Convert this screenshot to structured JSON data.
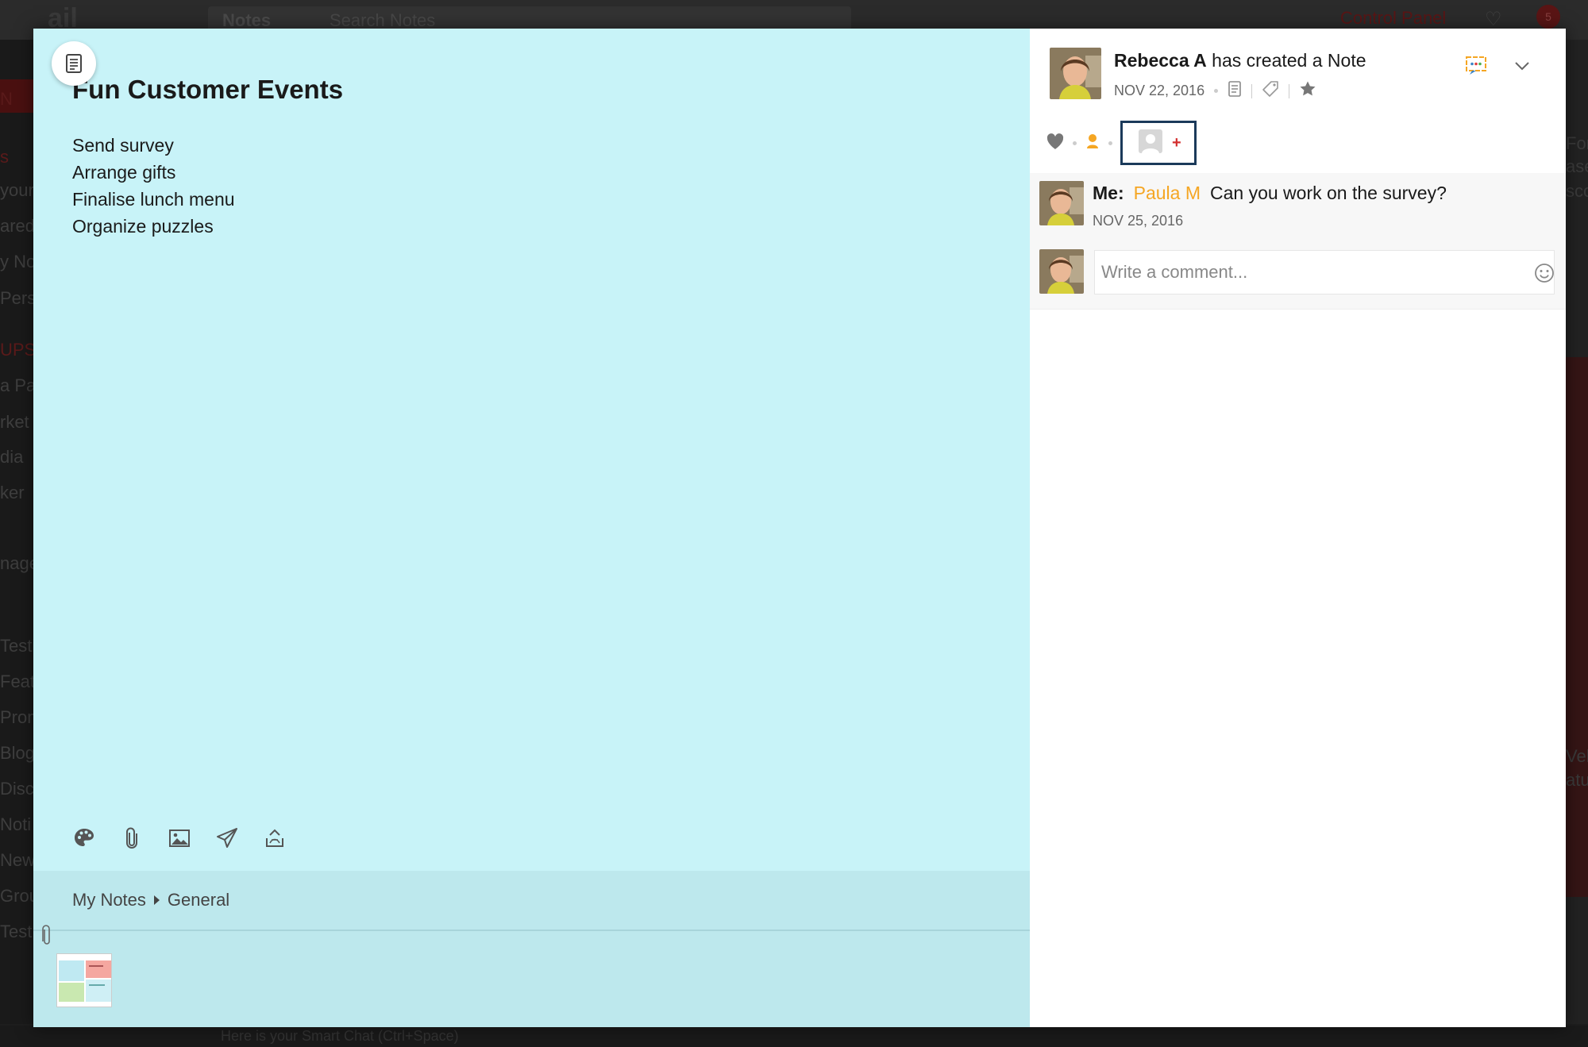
{
  "background": {
    "logo": "ail",
    "search_scope": "Notes",
    "search_placeholder": "Search Notes",
    "control_panel": "Control Panel",
    "notification_count": "5",
    "sidebar_fragments": [
      "N",
      "s",
      "youri",
      "ared",
      "y Not",
      "Perso",
      "UPS",
      "a Pa",
      "rket",
      "dia",
      "ker",
      "nage",
      "Testi",
      "Feat",
      "Prom",
      "Blog",
      "Disc",
      "Noti",
      "New",
      "Grou",
      "Test"
    ],
    "right_fragments": [
      "For",
      "ase",
      "sco",
      "Veb",
      "atu"
    ],
    "bottom_text": "Here is your Smart Chat (Ctrl+Space)"
  },
  "note": {
    "title": "Fun Customer Events",
    "lines": [
      "Send survey",
      "Arrange gifts",
      "Finalise lunch menu",
      "Organize puzzles"
    ],
    "toolbar": [
      "palette-icon",
      "attach-icon",
      "image-icon",
      "send-icon",
      "scan-icon"
    ],
    "breadcrumb": {
      "root": "My Notes",
      "child": "General"
    }
  },
  "feed": {
    "author": "Rebecca A",
    "action": "has created a Note",
    "date": "NOV 22, 2016",
    "comment": {
      "prefix": "Me:",
      "mention": "Paula M",
      "text": "Can you work on the survey?",
      "date": "NOV 25, 2016"
    },
    "comment_placeholder": "Write a comment...",
    "assign_plus": "+"
  },
  "colors": {
    "note_bg": "#c8f3f8",
    "footer_bg": "#bde8ed",
    "mention": "#f5a623",
    "assign_border": "#1b3a5a"
  }
}
